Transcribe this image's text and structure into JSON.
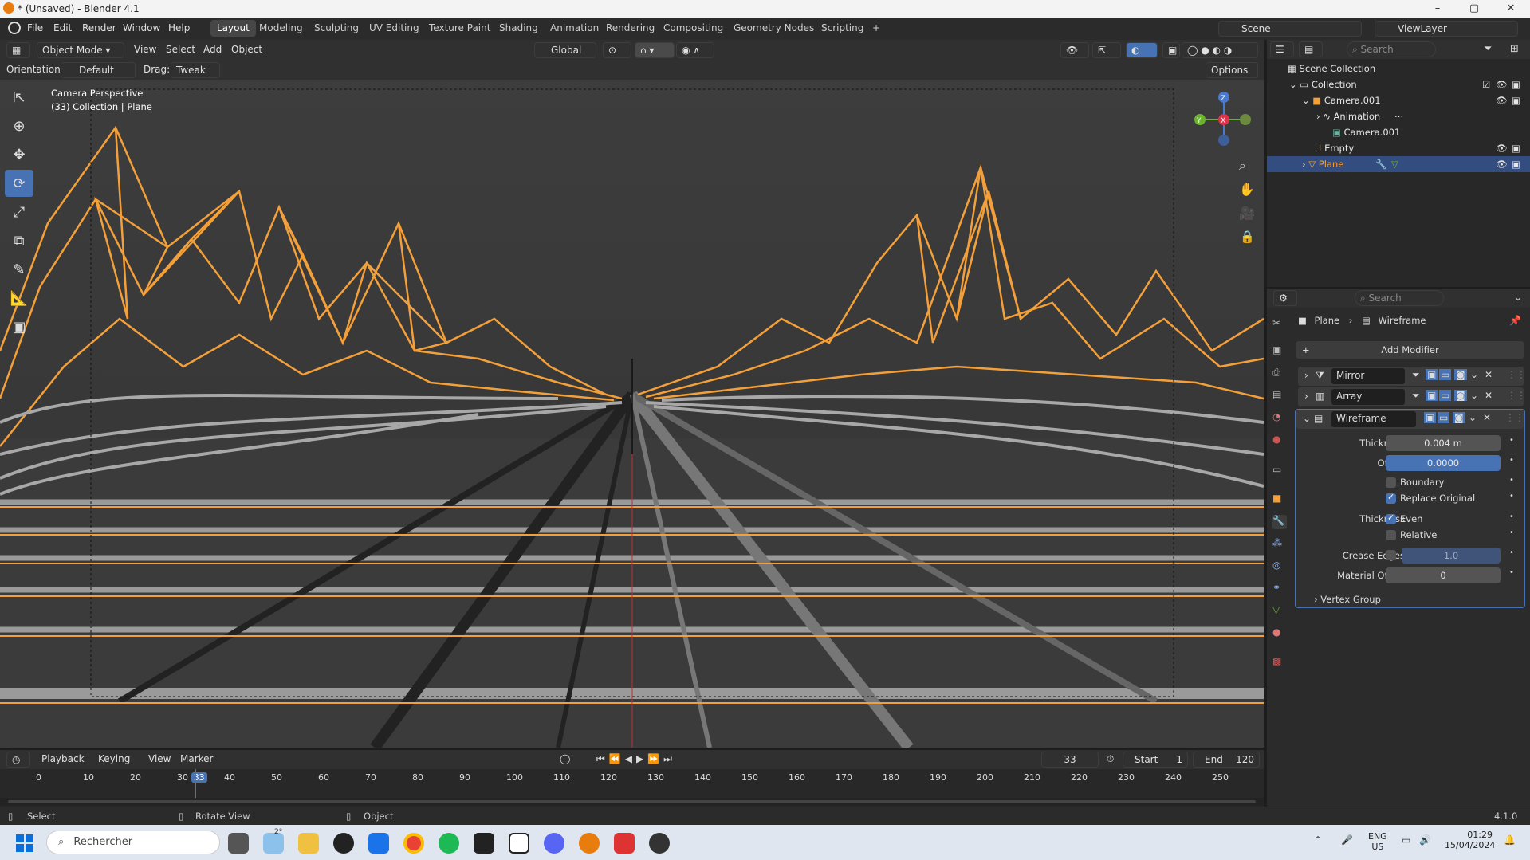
{
  "window": {
    "title": "* (Unsaved) - Blender 4.1"
  },
  "menu": {
    "items": [
      "File",
      "Edit",
      "Render",
      "Window",
      "Help"
    ]
  },
  "workspaces": {
    "tabs": [
      "Layout",
      "Modeling",
      "Sculpting",
      "UV Editing",
      "Texture Paint",
      "Shading",
      "Animation",
      "Rendering",
      "Compositing",
      "Geometry Nodes",
      "Scripting"
    ],
    "active": "Layout"
  },
  "scene": {
    "name": "Scene",
    "view_layer": "ViewLayer"
  },
  "viewport_header": {
    "mode": "Object Mode",
    "menus": [
      "View",
      "Select",
      "Add",
      "Object"
    ],
    "transform": "Global",
    "options": "Options"
  },
  "tool_settings": {
    "orientation_label": "Orientation:",
    "orientation_value": "Default",
    "drag_label": "Drag:",
    "drag_value": "Tweak"
  },
  "viewport": {
    "overlay_line1": "Camera Perspective",
    "overlay_line2": "(33) Collection | Plane"
  },
  "outliner": {
    "search_placeholder": "Search",
    "rows": [
      "Scene Collection",
      "Collection",
      "Camera.001",
      "Animation",
      "Camera.001",
      "Empty",
      "Plane"
    ]
  },
  "properties": {
    "search_placeholder": "Search",
    "breadcrumb_object": "Plane",
    "breadcrumb_modifier": "Wireframe",
    "add_modifier": "Add Modifier",
    "modifiers": [
      "Mirror",
      "Array",
      "Wireframe"
    ],
    "wireframe": {
      "thickness_label": "Thickness",
      "thickness_value": "0.004 m",
      "offset_label": "Offset",
      "offset_value": "0.0000",
      "boundary_label": "Boundary",
      "replace_original_label": "Replace Original",
      "thickness2_label": "Thickness",
      "even_label": "Even",
      "relative_label": "Relative",
      "crease_edges_label": "Crease Edges",
      "crease_edges_value": "1.0",
      "material_offset_label": "Material Offset",
      "material_offset_value": "0",
      "vertex_group_label": "Vertex Group"
    }
  },
  "timeline": {
    "menus": [
      "Playback",
      "Keying",
      "View",
      "Marker"
    ],
    "current_frame": "33",
    "start_label": "Start",
    "start_value": "1",
    "end_label": "End",
    "end_value": "120",
    "ticks": [
      "0",
      "10",
      "20",
      "30",
      "33",
      "40",
      "50",
      "60",
      "70",
      "80",
      "90",
      "100",
      "110",
      "120",
      "130",
      "140",
      "150",
      "160",
      "170",
      "180",
      "190",
      "200",
      "210",
      "220",
      "230",
      "240",
      "250"
    ]
  },
  "status": {
    "select": "Select",
    "rotate_view": "Rotate View",
    "object": "Object",
    "version": "4.1.0"
  },
  "taskbar": {
    "search_placeholder": "Rechercher",
    "lang1": "ENG",
    "lang2": "US",
    "time": "01:29",
    "date": "15/04/2024",
    "weather": "2°"
  },
  "colors": {
    "accent": "#4772b3",
    "wire_orange": "#f4a03a",
    "selected_row": "#334d80"
  }
}
